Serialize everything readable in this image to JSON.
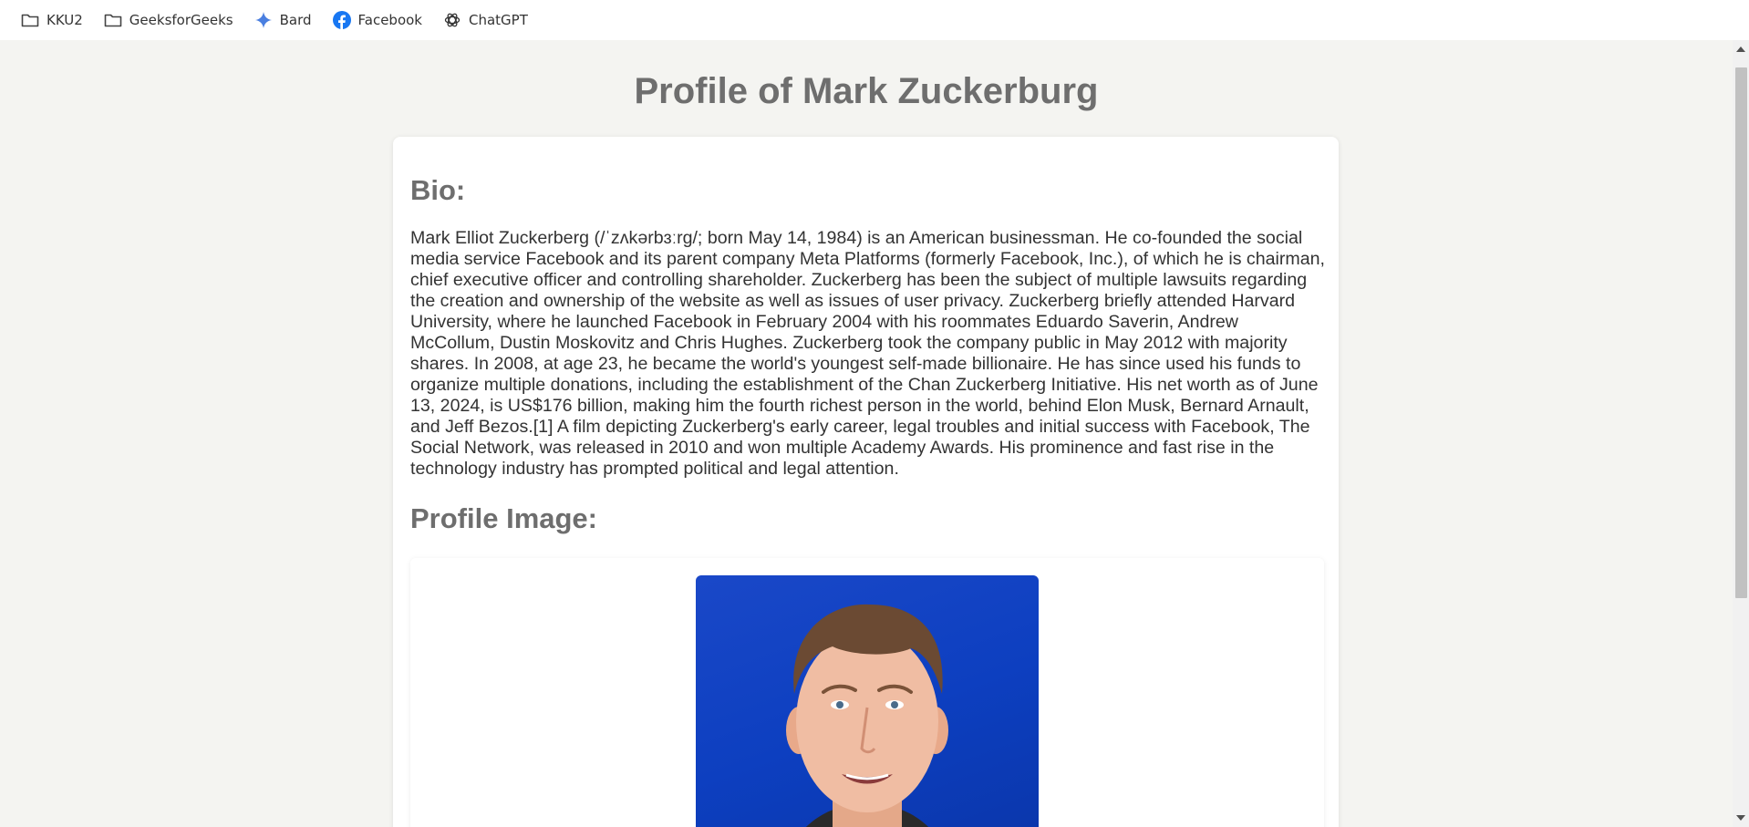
{
  "bookmarks": [
    {
      "label": "KKU2",
      "icon": "folder-icon"
    },
    {
      "label": "GeeksforGeeks",
      "icon": "folder-icon"
    },
    {
      "label": "Bard",
      "icon": "bard-sparkle-icon"
    },
    {
      "label": "Facebook",
      "icon": "facebook-icon"
    },
    {
      "label": "ChatGPT",
      "icon": "chatgpt-icon"
    }
  ],
  "page": {
    "title": "Profile of Mark Zuckerburg",
    "bio_heading": "Bio:",
    "bio_text": "Mark Elliot Zuckerberg (/ˈzʌkərbɜːrɡ/; born May 14, 1984) is an American businessman. He co-founded the social media service Facebook and its parent company Meta Platforms (formerly Facebook, Inc.), of which he is chairman, chief executive officer and controlling shareholder. Zuckerberg has been the subject of multiple lawsuits regarding the creation and ownership of the website as well as issues of user privacy. Zuckerberg briefly attended Harvard University, where he launched Facebook in February 2004 with his roommates Eduardo Saverin, Andrew McCollum, Dustin Moskovitz and Chris Hughes. Zuckerberg took the company public in May 2012 with majority shares. In 2008, at age 23, he became the world's youngest self-made billionaire. He has since used his funds to organize multiple donations, including the establishment of the Chan Zuckerberg Initiative. His net worth as of June 13, 2024, is US$176 billion, making him the fourth richest person in the world, behind Elon Musk, Bernard Arnault, and Jeff Bezos.[1] A film depicting Zuckerberg's early career, legal troubles and initial success with Facebook, The Social Network, was released in 2010 and won multiple Academy Awards. His prominence and fast rise in the technology industry has prompted political and legal attention.",
    "image_heading": "Profile Image:"
  },
  "colors": {
    "heading": "#6e6e6e",
    "background": "#f4f4f1",
    "photo_background": "#0d3fc0"
  }
}
